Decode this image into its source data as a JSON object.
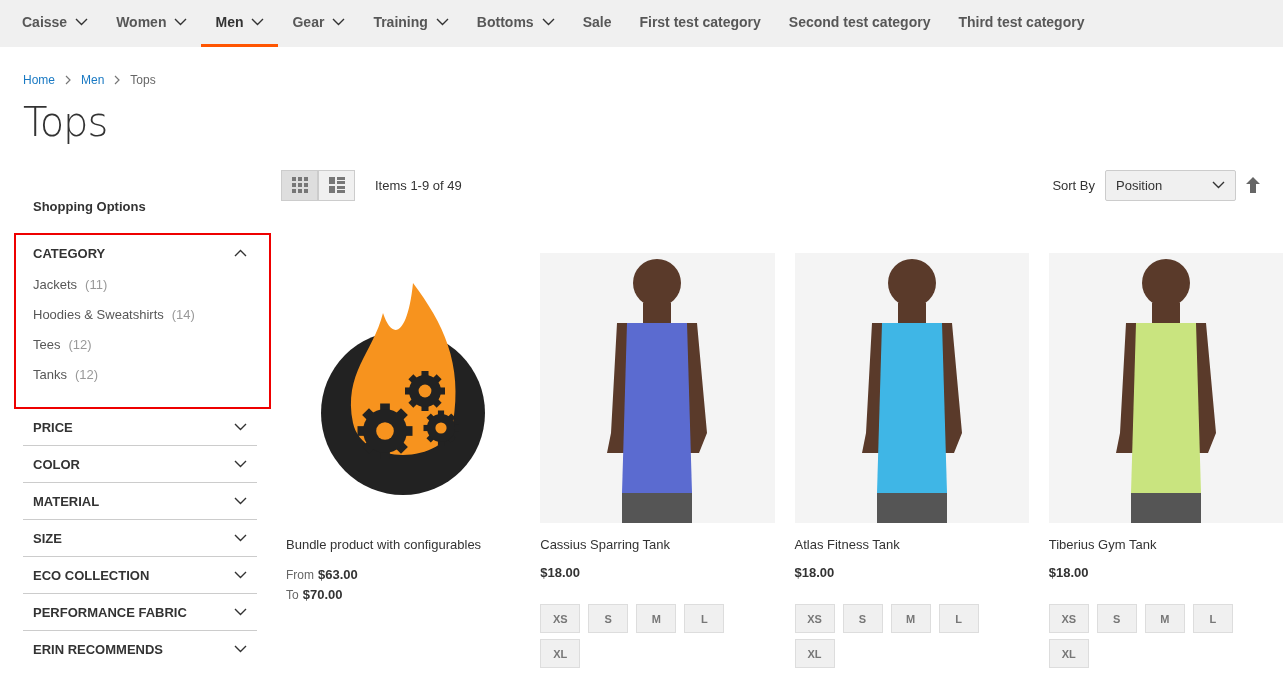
{
  "nav": [
    {
      "label": "Caisse",
      "dropdown": true,
      "selected": false
    },
    {
      "label": "Women",
      "dropdown": true,
      "selected": false
    },
    {
      "label": "Men",
      "dropdown": true,
      "selected": true
    },
    {
      "label": "Gear",
      "dropdown": true,
      "selected": false
    },
    {
      "label": "Training",
      "dropdown": true,
      "selected": false
    },
    {
      "label": "Bottoms",
      "dropdown": true,
      "selected": false
    },
    {
      "label": "Sale",
      "dropdown": false,
      "selected": false
    },
    {
      "label": "First test category",
      "dropdown": false,
      "selected": false
    },
    {
      "label": "Second test category",
      "dropdown": false,
      "selected": false
    },
    {
      "label": "Third test category",
      "dropdown": false,
      "selected": false
    }
  ],
  "breadcrumbs": [
    {
      "label": "Home",
      "link": true
    },
    {
      "label": "Men",
      "link": true
    },
    {
      "label": "Tops",
      "link": false
    }
  ],
  "title": "Tops",
  "sidebar": {
    "heading": "Shopping Options",
    "filters": [
      {
        "label": "CATEGORY",
        "expanded": true,
        "highlighted": true,
        "options": [
          {
            "label": "Jackets",
            "count": "(11)"
          },
          {
            "label": "Hoodies & Sweatshirts",
            "count": "(14)"
          },
          {
            "label": "Tees",
            "count": "(12)"
          },
          {
            "label": "Tanks",
            "count": "(12)"
          }
        ]
      },
      {
        "label": "PRICE",
        "expanded": false,
        "highlighted": false
      },
      {
        "label": "COLOR",
        "expanded": false,
        "highlighted": false
      },
      {
        "label": "MATERIAL",
        "expanded": false,
        "highlighted": false
      },
      {
        "label": "SIZE",
        "expanded": false,
        "highlighted": false
      },
      {
        "label": "ECO COLLECTION",
        "expanded": false,
        "highlighted": false
      },
      {
        "label": "PERFORMANCE FABRIC",
        "expanded": false,
        "highlighted": false
      },
      {
        "label": "ERIN RECOMMENDS",
        "expanded": false,
        "highlighted": false
      }
    ]
  },
  "toolbar": {
    "views": [
      {
        "kind": "grid",
        "selected": true
      },
      {
        "kind": "list",
        "selected": false
      }
    ],
    "count": "Items 1-9 of 49",
    "sort_label": "Sort By",
    "sort_value": "Position"
  },
  "products": [
    {
      "kind": "bundle",
      "name": "Bundle product with configurables",
      "from_label": "From",
      "from_price": "$63.00",
      "to_label": "To",
      "to_price": "$70.00"
    },
    {
      "kind": "simple",
      "name": "Cassius Sparring Tank",
      "price": "$18.00",
      "sizes": [
        "XS",
        "S",
        "M",
        "L",
        "XL"
      ]
    },
    {
      "kind": "simple",
      "name": "Atlas Fitness Tank",
      "price": "$18.00",
      "sizes": [
        "XS",
        "S",
        "M",
        "L",
        "XL"
      ]
    },
    {
      "kind": "simple",
      "name": "Tiberius Gym Tank",
      "price": "$18.00",
      "sizes": [
        "XS",
        "S",
        "M",
        "L",
        "XL"
      ]
    }
  ]
}
